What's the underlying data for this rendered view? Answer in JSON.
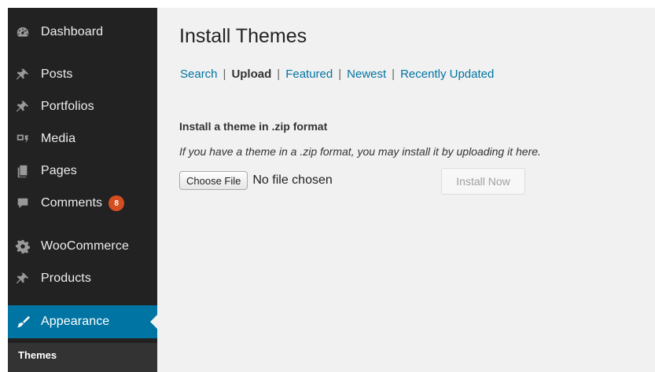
{
  "sidebar": {
    "items": [
      {
        "label": "Dashboard",
        "icon": "dashboard-icon"
      },
      {
        "label": "Posts",
        "icon": "pin-icon"
      },
      {
        "label": "Portfolios",
        "icon": "pin-icon"
      },
      {
        "label": "Media",
        "icon": "media-icon"
      },
      {
        "label": "Pages",
        "icon": "pages-icon"
      },
      {
        "label": "Comments",
        "icon": "comment-icon",
        "badge": "8"
      },
      {
        "label": "WooCommerce",
        "icon": "gear-icon"
      },
      {
        "label": "Products",
        "icon": "pin-icon"
      },
      {
        "label": "Appearance",
        "icon": "brush-icon",
        "active": true
      }
    ],
    "submenu": {
      "label": "Themes"
    }
  },
  "page": {
    "title": "Install Themes",
    "subnav": {
      "search": "Search",
      "upload": "Upload",
      "featured": "Featured",
      "newest": "Newest",
      "recently_updated": "Recently Updated",
      "separator": "|"
    },
    "upload": {
      "heading": "Install a theme in .zip format",
      "description": "If you have a theme in a .zip format, you may install it by uploading it here.",
      "choose_file_label": "Choose File",
      "no_file_text": "No file chosen",
      "install_label": "Install Now"
    }
  },
  "colors": {
    "sidebar_bg": "#222222",
    "active_bg": "#0074a2",
    "link": "#0074a2",
    "badge": "#d54e21",
    "content_bg": "#f1f1f1"
  }
}
